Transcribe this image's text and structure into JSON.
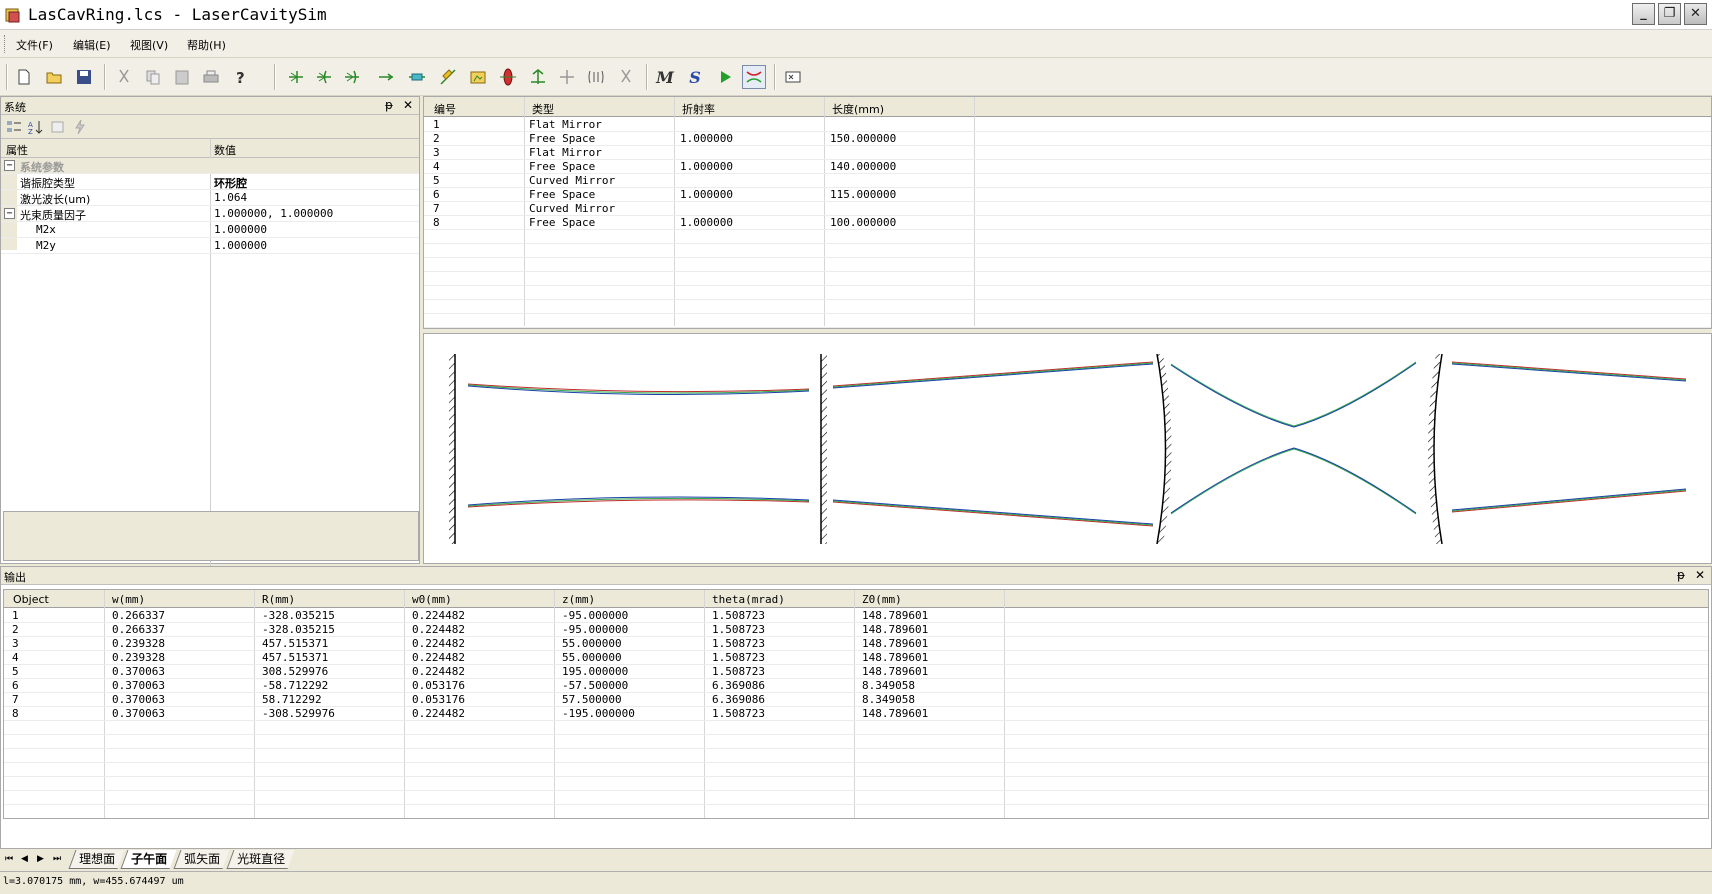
{
  "window": {
    "title": "LasCavRing.lcs - LaserCavitySim",
    "buttons": {
      "minimize": "_",
      "restore": "❐",
      "close": "✕"
    }
  },
  "menu": {
    "items": [
      {
        "label": "文件(F)"
      },
      {
        "label": "编辑(E)"
      },
      {
        "label": "视图(V)"
      },
      {
        "label": "帮助(H)"
      }
    ]
  },
  "toolbar": {
    "m_label": "M",
    "s_label": "S",
    "icons": [
      "new-file-icon",
      "open-folder-icon",
      "save-icon",
      "cut-icon",
      "copy-icon",
      "paste-icon",
      "print-icon",
      "help-icon",
      "flat-mirror-icon",
      "curved-mirror-icon",
      "thin-lens-icon",
      "free-space-icon",
      "crystal-icon",
      "pump-icon",
      "aperture-icon",
      "gain-medium-icon",
      "prism-icon",
      "beam-splitter-icon",
      "grating-icon",
      "scissors-icon",
      "run-icon",
      "beam-profile-icon",
      "view-icon"
    ]
  },
  "system_panel": {
    "title": "系统",
    "pin": "ᵽ",
    "close": "✕",
    "columns": {
      "property": "属性",
      "value": "数值"
    },
    "rows": [
      {
        "toggle": "⊟",
        "name": "系统参数",
        "value": "",
        "kind": "category"
      },
      {
        "name": "谐振腔类型",
        "value": "环形腔",
        "kind": "bold"
      },
      {
        "name": "激光波长(um)",
        "value": "1.064",
        "kind": "normal"
      },
      {
        "toggle": "⊟",
        "name": "光束质量因子",
        "value": "1.000000, 1.000000",
        "kind": "group"
      },
      {
        "name": "M2x",
        "value": "1.000000",
        "kind": "sub"
      },
      {
        "name": "M2y",
        "value": "1.000000",
        "kind": "sub"
      }
    ]
  },
  "component_grid": {
    "headers": [
      "编号",
      "类型",
      "折射率",
      "长度(mm)"
    ],
    "rows": [
      [
        "1",
        "Flat Mirror",
        "",
        ""
      ],
      [
        "2",
        "Free Space",
        "1.000000",
        "150.000000"
      ],
      [
        "3",
        "Flat Mirror",
        "",
        ""
      ],
      [
        "4",
        "Free Space",
        "1.000000",
        "140.000000"
      ],
      [
        "5",
        "Curved Mirror",
        "",
        ""
      ],
      [
        "6",
        "Free Space",
        "1.000000",
        "115.000000"
      ],
      [
        "7",
        "Curved Mirror",
        "",
        ""
      ],
      [
        "8",
        "Free Space",
        "1.000000",
        "100.000000"
      ]
    ]
  },
  "output_panel": {
    "title": "输出",
    "pin": "ᵽ",
    "close": "✕",
    "headers": [
      "Object",
      "w(mm)",
      "R(mm)",
      "w0(mm)",
      "z(mm)",
      "theta(mrad)",
      "Z0(mm)"
    ],
    "rows": [
      [
        "1",
        "0.266337",
        "-328.035215",
        "0.224482",
        "-95.000000",
        "1.508723",
        "148.789601"
      ],
      [
        "2",
        "0.266337",
        "-328.035215",
        "0.224482",
        "-95.000000",
        "1.508723",
        "148.789601"
      ],
      [
        "3",
        "0.239328",
        "457.515371",
        "0.224482",
        "55.000000",
        "1.508723",
        "148.789601"
      ],
      [
        "4",
        "0.239328",
        "457.515371",
        "0.224482",
        "55.000000",
        "1.508723",
        "148.789601"
      ],
      [
        "5",
        "0.370063",
        "308.529976",
        "0.224482",
        "195.000000",
        "1.508723",
        "148.789601"
      ],
      [
        "6",
        "0.370063",
        "-58.712292",
        "0.053176",
        "-57.500000",
        "6.369086",
        "8.349058"
      ],
      [
        "7",
        "0.370063",
        "58.712292",
        "0.053176",
        "57.500000",
        "6.369086",
        "8.349058"
      ],
      [
        "8",
        "0.370063",
        "-308.529976",
        "0.224482",
        "-195.000000",
        "1.508723",
        "148.789601"
      ]
    ]
  },
  "sheet_tabs": {
    "nav": [
      "⏮",
      "◀",
      "▶",
      "⏭"
    ],
    "tabs": [
      {
        "label": "理想面",
        "active": false
      },
      {
        "label": "子午面",
        "active": true
      },
      {
        "label": "弧矢面",
        "active": false
      },
      {
        "label": "光斑直径",
        "active": false
      }
    ]
  },
  "status": {
    "text": "l=3.070175 mm, w=455.674497 um"
  },
  "colors": {
    "beam_blue": "#1a3fa8",
    "beam_green": "#2ea84a",
    "beam_red": "#c02a2a",
    "beam_purple": "#7a2a9a"
  }
}
